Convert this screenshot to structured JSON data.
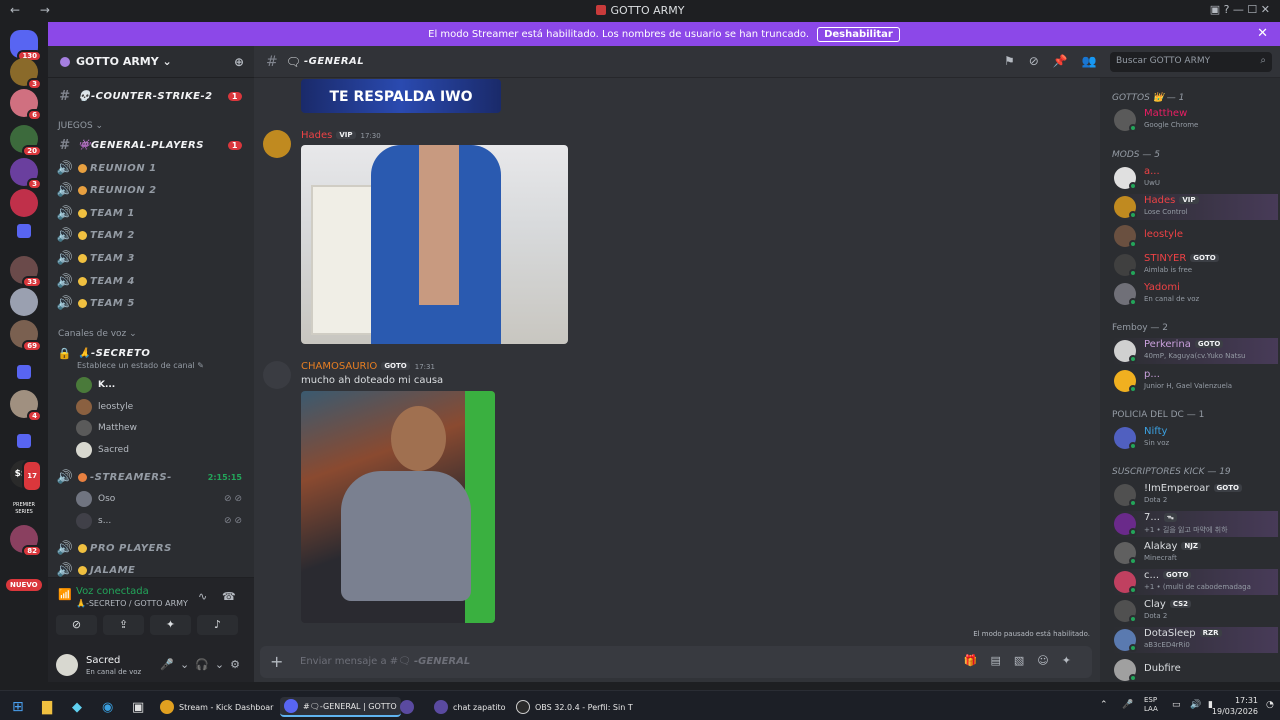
{
  "window": {
    "title": "GOTTO ARMY",
    "nav": "← →",
    "controls": "▣ ? — ☐ ✕"
  },
  "banner": {
    "text": "El modo Streamer está habilitado. Los nombres de usuario se han truncado.",
    "button": "Deshabilitar"
  },
  "servers": [
    {
      "badge": "130",
      "color": "#5865f2"
    },
    {
      "badge": "3",
      "color": "#8a6a2a"
    },
    {
      "badge": "6",
      "color": "#d07080"
    },
    {
      "badge": "20",
      "color": "#3c6a3c"
    },
    {
      "badge": "3",
      "color": "#6a3f9e"
    },
    {
      "badge": "",
      "color": "#c0304a"
    },
    {
      "badge": "",
      "color": "#5865f2"
    },
    {
      "badge": "33",
      "color": "#6a4a4a"
    },
    {
      "badge": "",
      "color": "#9aa0b0"
    },
    {
      "badge": "69",
      "color": "#7a6050"
    },
    {
      "badge": "",
      "color": "#5865f2"
    },
    {
      "badge": "4",
      "color": "#a09080"
    },
    {
      "badge": "",
      "color": "#5865f2"
    },
    {
      "badge": "17",
      "color": "#3a3a3a"
    },
    {
      "badge": "",
      "color": "#2a2a2a"
    },
    {
      "badge": "82",
      "color": "#8a4060"
    }
  ],
  "servers_new": "NUEVO",
  "server_labels": {
    "money": "$$$",
    "premier": "PREMIER SERIES"
  },
  "guild": {
    "name": "GOTTO ARMY ⌄"
  },
  "channels": {
    "counter": {
      "name": "💀-COUNTER-STRIKE-2",
      "badge": "1"
    },
    "cat_juegos": "JUEGOS ⌄",
    "general_players": {
      "name": "👾GENERAL-PLAYERS",
      "badge": "1"
    },
    "voice": [
      "REUNION 1",
      "REUNION 2",
      "TEAM 1",
      "TEAM 2",
      "TEAM 3",
      "TEAM 4",
      "TEAM 5"
    ],
    "cat_voz": "Canales de voz ⌄",
    "secreto": {
      "name": "🙏-SECRETO",
      "status": "Establece un estado de canal ✎"
    },
    "secreto_users": [
      "K...",
      "leostyle",
      "Matthew",
      "Sacred"
    ],
    "streamers": {
      "name": "-STREAMERS-",
      "time": "2:15:15"
    },
    "streamers_users": [
      "Oso",
      "s..."
    ],
    "pro_players": "PRO PLAYERS",
    "jalame": "JALAME"
  },
  "voice_panel": {
    "title": "Voz conectada",
    "sub": "🙏-SECRETO / GOTTO ARMY"
  },
  "user": {
    "name": "Sacred",
    "status": "En canal de voz"
  },
  "channel_header": {
    "name": "-GENERAL"
  },
  "search": {
    "placeholder": "Buscar GOTTO ARMY"
  },
  "messages": {
    "banner_text": "TE RESPALDA IWO",
    "m1": {
      "name": "Hades",
      "tag": "VIP",
      "time": "17:30"
    },
    "m2": {
      "name": "CHAMOSAURIO",
      "tag": "GOTO",
      "time": "17:31",
      "text": "mucho ah doteado mi causa"
    }
  },
  "paused": "El modo pausado está habilitado.",
  "composer": {
    "prefix": "Enviar mensaje a #",
    "channel": "-GENERAL"
  },
  "members": {
    "cat1": "GOTTOS 👑 — 1",
    "cat2": "MODS — 5",
    "cat3": "Femboy — 2",
    "cat4": "POLICIA DEL DC — 1",
    "cat5": "SUSCRIPTORES KICK — 19",
    "list": [
      {
        "name": "Matthew",
        "status": "Google Chrome",
        "color": "#e91e63",
        "tag": ""
      },
      {
        "name": "a...",
        "status": "UwU",
        "color": "#ed4245",
        "tag": ""
      },
      {
        "name": "Hades",
        "status": "Lose Control",
        "color": "#ed4245",
        "tag": "VIP"
      },
      {
        "name": "leostyle",
        "status": "",
        "color": "#ed4245",
        "tag": ""
      },
      {
        "name": "STINYER",
        "status": "Aimlab is free",
        "color": "#ed4245",
        "tag": "GOTO"
      },
      {
        "name": "Yadomi",
        "status": "En canal de voz",
        "color": "#ed4245",
        "tag": ""
      },
      {
        "name": "Perkerina",
        "status": "40mP, Kaguya(cv.Yuko Natsu",
        "color": "#c9a0dc",
        "tag": "GOTO"
      },
      {
        "name": "p...",
        "status": "Junior H, Gael Valenzuela",
        "color": "#c9a0dc",
        "tag": ""
      },
      {
        "name": "Nifty",
        "status": "Sin voz",
        "color": "#3ba0e0",
        "tag": ""
      },
      {
        "name": "!ImEmperoar",
        "status": "Dota 2",
        "color": "#dbdee1",
        "tag": "GOTO"
      },
      {
        "name": "7...",
        "status": "+1 • 길을 잃고 마약에 취하",
        "color": "#dbdee1",
        "tag": "ᯓ"
      },
      {
        "name": "Alakay",
        "status": "Minecraft",
        "color": "#dbdee1",
        "tag": "NJZ"
      },
      {
        "name": "c...",
        "status": "+1 • (multi de cabodemadaga",
        "color": "#dbdee1",
        "tag": "GOTO"
      },
      {
        "name": "Clay",
        "status": "Dota 2",
        "color": "#dbdee1",
        "tag": "CS2"
      },
      {
        "name": "DotaSleep",
        "status": "aB3cED4rRi0",
        "color": "#dbdee1",
        "tag": "RZR"
      },
      {
        "name": "Dubfire",
        "status": "",
        "color": "#dbdee1",
        "tag": ""
      }
    ]
  },
  "taskbar": {
    "kick": "Stream - Kick Dashboar",
    "discord": "#🗨-GENERAL | GOTTO",
    "chat": "chat zapatito",
    "obs": "OBS 32.0.4 - Perfil: Sin T",
    "lang1": "ESP",
    "lang2": "LAA",
    "time": "17:31",
    "date": "19/03/2026"
  },
  "colors": {
    "accent": "#8c48e8",
    "online": "#23a55a",
    "badge": "#da373c"
  }
}
